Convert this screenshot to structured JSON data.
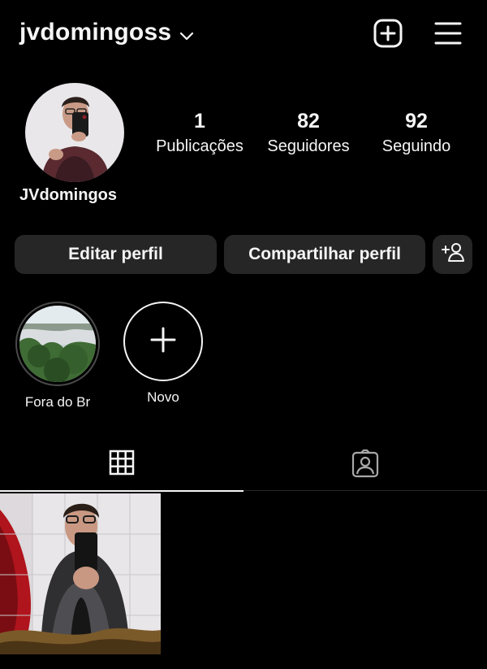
{
  "header": {
    "username": "jvdomingoss",
    "icons": {
      "dropdown": "chevron-down-icon",
      "create": "plus-square-icon",
      "menu": "hamburger-menu-icon"
    }
  },
  "profile": {
    "display_name": "JVdomingos",
    "stats": {
      "posts": {
        "value": "1",
        "label": "Publicações"
      },
      "followers": {
        "value": "82",
        "label": "Seguidores"
      },
      "following": {
        "value": "92",
        "label": "Seguindo"
      }
    }
  },
  "actions": {
    "edit_label": "Editar perfil",
    "share_label": "Compartilhar perfil",
    "discover_icon": "add-person-icon"
  },
  "highlights": [
    {
      "label": "Fora do Br"
    },
    {
      "label": "Novo"
    }
  ],
  "tabs": [
    {
      "icon": "grid-icon",
      "active": true
    },
    {
      "icon": "tagged-person-icon",
      "active": false
    }
  ],
  "colors": {
    "background": "#000000",
    "button": "#262626",
    "text": "#f5f5f5"
  }
}
